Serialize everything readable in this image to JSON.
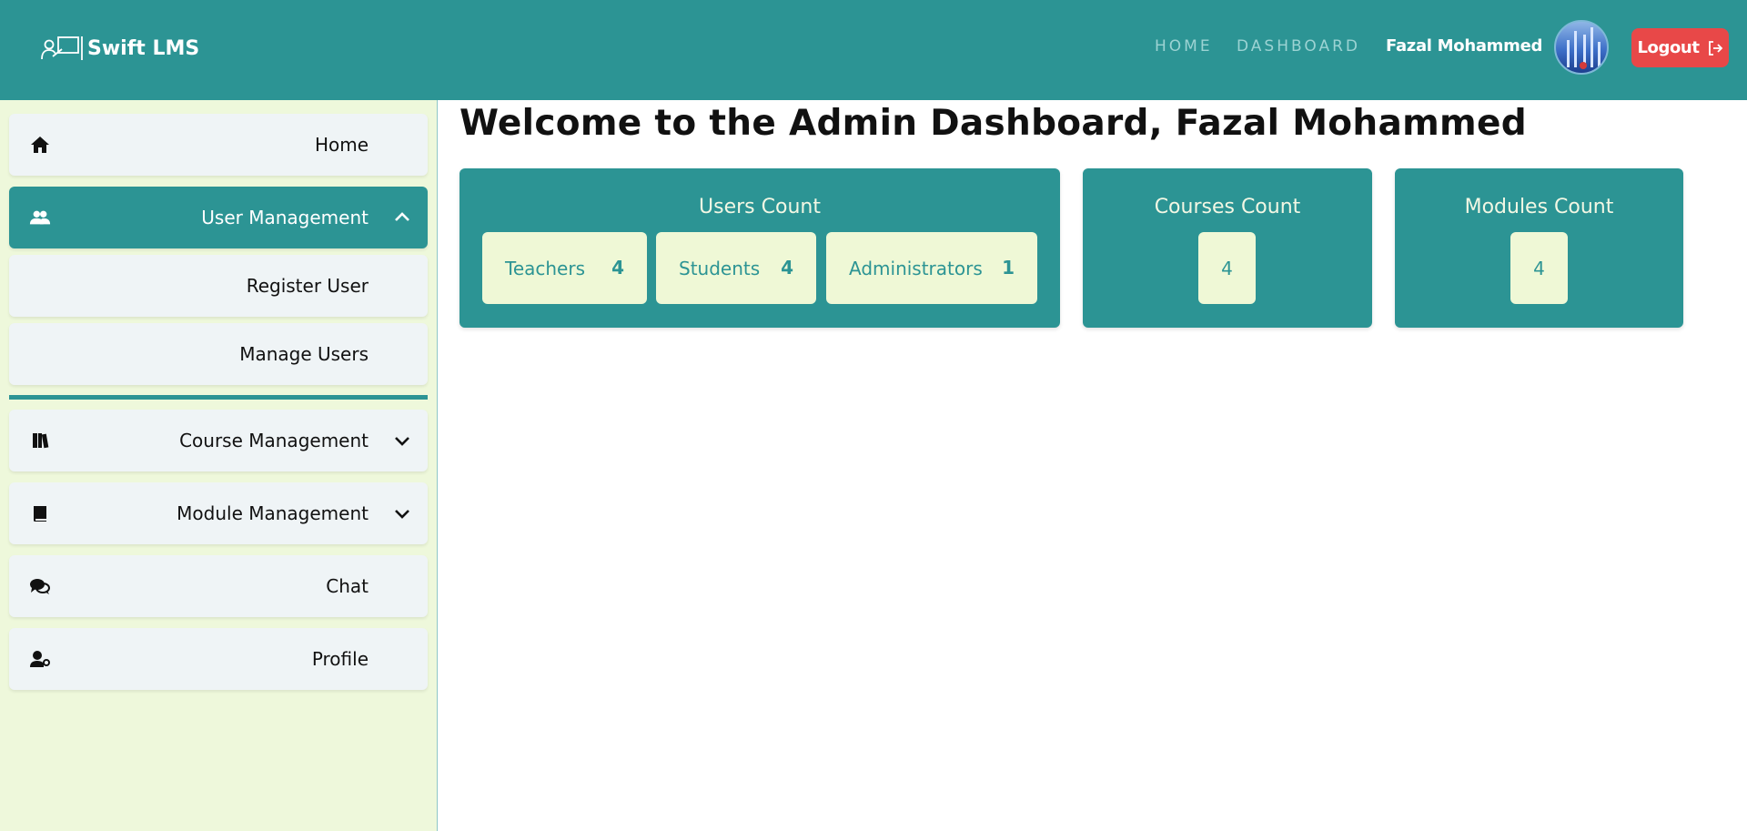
{
  "header": {
    "brand": "Swift LMS",
    "nav_home": "HOME",
    "nav_dashboard": "DASHBOARD",
    "user_name": "Fazal Mohammed",
    "logout_label": "Logout",
    "logout_icon": "sign-out-icon"
  },
  "sidebar": {
    "items": [
      {
        "label": "Home",
        "icon": "home-icon"
      },
      {
        "label": "User Management",
        "icon": "users-icon",
        "expanded": true
      },
      {
        "label": "Register User"
      },
      {
        "label": "Manage Users"
      },
      {
        "label": "Course Management",
        "icon": "books-icon",
        "expanded": false
      },
      {
        "label": "Module Management",
        "icon": "book-icon",
        "expanded": false
      },
      {
        "label": "Chat",
        "icon": "chat-icon"
      },
      {
        "label": "Profile",
        "icon": "user-gear-icon"
      }
    ]
  },
  "main": {
    "title": "Welcome to the Admin Dashboard, Fazal Mohammed",
    "users_card": {
      "title": "Users Count",
      "teachers_label": "Teachers",
      "teachers_value": "4",
      "students_label": "Students",
      "students_value": "4",
      "admins_label": "Administrators",
      "admins_value": "1"
    },
    "courses_card": {
      "title": "Courses Count",
      "value": "4"
    },
    "modules_card": {
      "title": "Modules Count",
      "value": "4"
    }
  },
  "colors": {
    "primary": "#2c9494",
    "sidebar_bg": "#eef8db",
    "pill_bg": "#eff8d6",
    "logout": "#e84848"
  }
}
